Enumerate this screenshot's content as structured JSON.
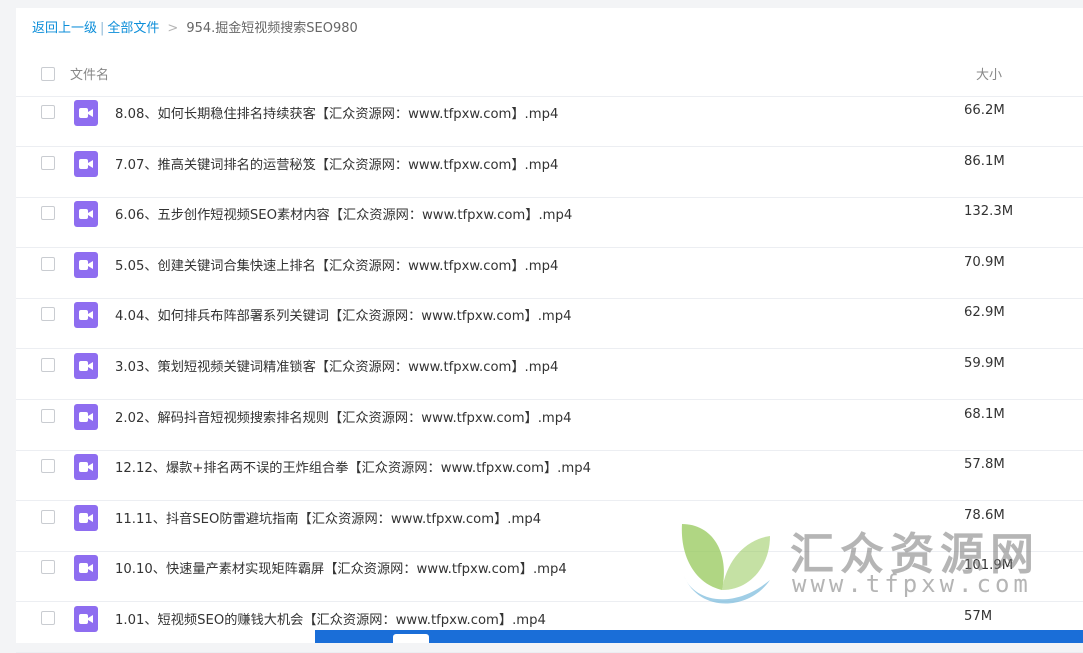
{
  "breadcrumb": {
    "back": "返回上一级",
    "all_files": "全部文件",
    "separator": "|",
    "arrow": ">",
    "current": "954.掘金短视频搜索SEO980"
  },
  "header": {
    "name_label": "文件名",
    "size_label": "大小"
  },
  "files": [
    {
      "name": "8.08、如何长期稳住排名持续获客【汇众资源网：www.tfpxw.com】.mp4",
      "size": "66.2M"
    },
    {
      "name": "7.07、推高关键词排名的运营秘笈【汇众资源网：www.tfpxw.com】.mp4",
      "size": "86.1M"
    },
    {
      "name": "6.06、五步创作短视频SEO素材内容【汇众资源网：www.tfpxw.com】.mp4",
      "size": "132.3M"
    },
    {
      "name": "5.05、创建关键词合集快速上排名【汇众资源网：www.tfpxw.com】.mp4",
      "size": "70.9M"
    },
    {
      "name": "4.04、如何排兵布阵部署系列关键词【汇众资源网：www.tfpxw.com】.mp4",
      "size": "62.9M"
    },
    {
      "name": "3.03、策划短视频关键词精准锁客【汇众资源网：www.tfpxw.com】.mp4",
      "size": "59.9M"
    },
    {
      "name": "2.02、解码抖音短视频搜索排名规则【汇众资源网：www.tfpxw.com】.mp4",
      "size": "68.1M"
    },
    {
      "name": "12.12、爆款+排名两不误的王炸组合拳【汇众资源网：www.tfpxw.com】.mp4",
      "size": "57.8M"
    },
    {
      "name": "11.11、抖音SEO防雷避坑指南【汇众资源网：www.tfpxw.com】.mp4",
      "size": "78.6M"
    },
    {
      "name": "10.10、快速量产素材实现矩阵霸屏【汇众资源网：www.tfpxw.com】.mp4",
      "size": "101.9M"
    },
    {
      "name": "1.01、短视频SEO的赚钱大机会【汇众资源网：www.tfpxw.com】.mp4",
      "size": "57M"
    }
  ],
  "file_icon": "video-file-icon",
  "watermark": {
    "title": "汇众资源网",
    "url": "www.tfpxw.com"
  },
  "colors": {
    "link": "#0c8ed9",
    "video_icon": "#8e6df0",
    "bottom_bar": "#1a6ed8"
  }
}
